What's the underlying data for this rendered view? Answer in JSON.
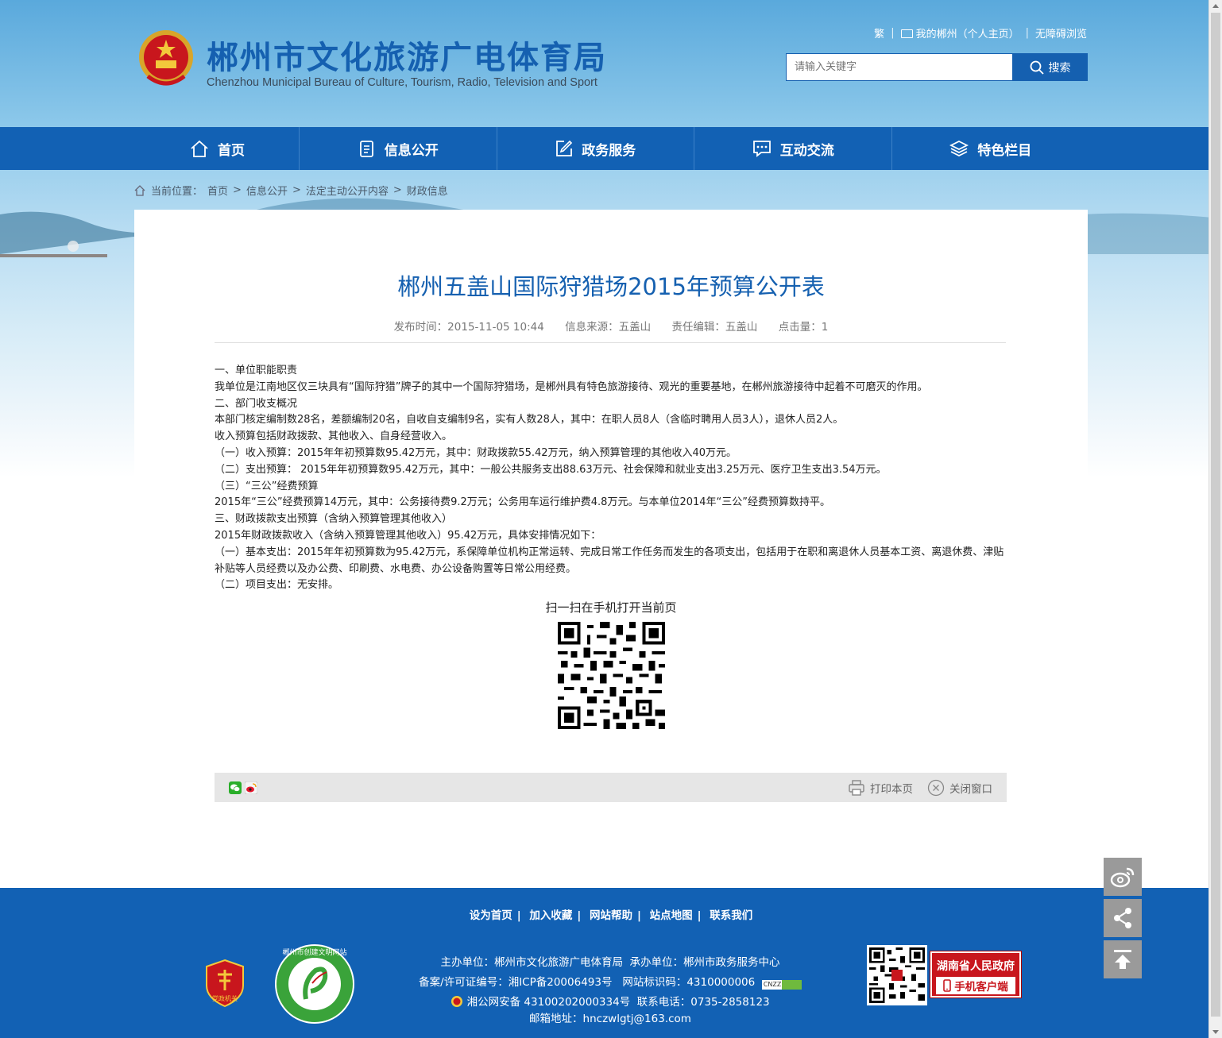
{
  "header": {
    "title": "郴州市文化旅游广电体育局",
    "subtitle": "Chenzhou Municipal Bureau of Culture, Tourism, Radio, Television and Sport",
    "top_links": {
      "traditional": "繁",
      "my_chenzhou": "我的郴州（个人主页）",
      "accessible": "无障碍浏览"
    },
    "search": {
      "placeholder": "请输入关键字",
      "button_label": "搜索"
    }
  },
  "nav": {
    "items": [
      {
        "label": "首页",
        "icon": "home-icon"
      },
      {
        "label": "信息公开",
        "icon": "document-icon"
      },
      {
        "label": "政务服务",
        "icon": "edit-icon"
      },
      {
        "label": "互动交流",
        "icon": "chat-icon"
      },
      {
        "label": "特色栏目",
        "icon": "layers-icon"
      }
    ]
  },
  "breadcrumb": {
    "prefix": "当前位置：",
    "items": [
      "首页",
      "信息公开",
      "法定主动公开内容",
      "财政信息"
    ],
    "separator": ">"
  },
  "article": {
    "title": "郴州五盖山国际狩猎场2015年预算公开表",
    "meta": {
      "publish_time": "发布时间：2015-11-05 10:44",
      "source": "信息来源：五盖山",
      "editor": "责任编辑：五盖山",
      "hits": "点击量：1"
    },
    "paragraphs": [
      "一、单位职能职责",
      "我单位是江南地区仅三块具有“国际狩猎”牌子的其中一个国际狩猎场，是郴州具有特色旅游接待、观光的重要基地，在郴州旅游接待中起着不可磨灭的作用。",
      "二、部门收支概况",
      "本部门核定编制数28名，差额编制20名，自收自支编制9名，实有人数28人，其中：在职人员8人（含临时聘用人员3人），退休人员2人。",
      "收入预算包括财政拨款、其他收入、自身经营收入。",
      "（一）收入预算：2015年年初预算数95.42万元，其中：财政拨款55.42万元，纳入预算管理的其他收入40万元。",
      "（二）支出预算： 2015年年初预算数95.42万元，其中：一般公共服务支出88.63万元、社会保障和就业支出3.25万元、医疗卫生支出3.54万元。",
      "（三）“三公”经费预算",
      "2015年“三公”经费预算14万元，其中：公务接待费9.2万元；公务用车运行维护费4.8万元。与本单位2014年“三公”经费预算数持平。",
      "三、财政拨款支出预算（含纳入预算管理其他收入）",
      "2015年财政拨款收入（含纳入预算管理其他收入）95.42万元，具体安排情况如下：",
      "（一）基本支出：2015年年初预算数为95.42万元，系保障单位机构正常运转、完成日常工作任务而发生的各项支出，包括用于在职和离退休人员基本工资、离退休费、津贴补贴等人员经费以及办公费、印刷费、水电费、办公设备购置等日常公用经费。",
      "（二）项目支出：无安排。"
    ],
    "qr_caption": "扫一扫在手机打开当前页",
    "print_label": "打印本页",
    "close_label": "关闭窗口"
  },
  "footer": {
    "links": [
      "设为首页",
      "加入收藏",
      "网站帮助",
      "站点地图",
      "联系我们"
    ],
    "sponsor": "主办单位：郴州市文化旅游广电体育局",
    "undertaker": "承办单位：郴州市政务服务中心",
    "icp": "备案/许可证编号：湘ICP备20006493号",
    "site_code": "网站标识码：4310000006",
    "cnzz": "CNZZ",
    "police": "湘公网安备 43100202000334号",
    "phone": "联系电话：0735-2858123",
    "email": "邮箱地址：hnczwlgtj@163.com",
    "party_badge": "党政机关",
    "civil_badge": "郴州市创建文明网站",
    "mobile_title": "湖南省人民政府",
    "mobile_client": "手机客户端"
  },
  "colors": {
    "primary": "#1261b4",
    "title_blue": "#1560b0",
    "badge_red": "#c8161d"
  }
}
